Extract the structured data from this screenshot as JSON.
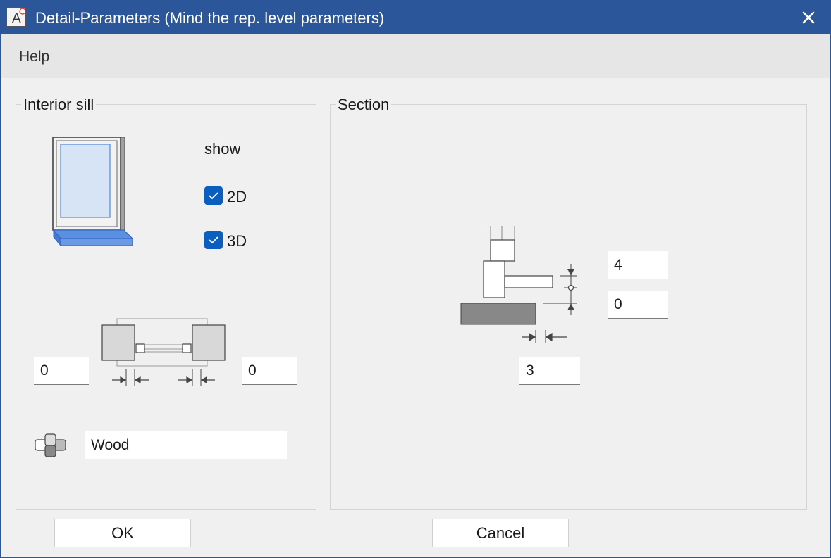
{
  "window": {
    "title": "Detail-Parameters (Mind the rep. level parameters)",
    "app_icon_letter": "A"
  },
  "menu": {
    "items": [
      {
        "label": "Help"
      }
    ]
  },
  "interior_sill": {
    "legend": "Interior sill",
    "show_label": "show",
    "checkbox_2d": {
      "label": "2D",
      "checked": true
    },
    "checkbox_3d": {
      "label": "3D",
      "checked": true
    },
    "left_offset": "0",
    "right_offset": "0",
    "material": "Wood"
  },
  "section": {
    "legend": "Section",
    "top_value": "4",
    "mid_value": "0",
    "bottom_value": "3"
  },
  "buttons": {
    "ok": "OK",
    "cancel": "Cancel"
  },
  "colors": {
    "titlebar": "#2b579a",
    "checkbox": "#0a5ec0",
    "glass": "#d6e4f6",
    "sill": "#5b8fe0"
  }
}
